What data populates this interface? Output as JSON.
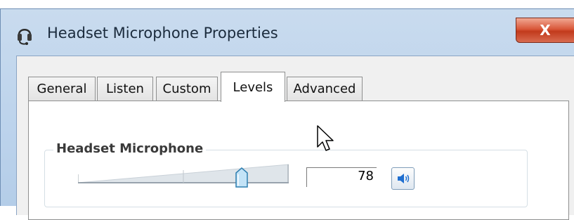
{
  "window": {
    "title": "Headset Microphone Properties",
    "close_symbol": "X",
    "icons": {
      "app": "headset-icon",
      "close": "close-icon"
    }
  },
  "tabs": [
    {
      "label": "General",
      "selected": false
    },
    {
      "label": "Listen",
      "selected": false
    },
    {
      "label": "Custom",
      "selected": false
    },
    {
      "label": "Levels",
      "selected": true
    },
    {
      "label": "Advanced",
      "selected": false
    }
  ],
  "levels": {
    "group_label": "Headset Microphone",
    "volume_value": "78",
    "volume_fraction": 0.78,
    "mute_icon": "speaker-icon"
  },
  "colors": {
    "accent_blue": "#1f6fd0",
    "close_red": "#c23a1c",
    "title_bar": "#bcd3ec"
  }
}
